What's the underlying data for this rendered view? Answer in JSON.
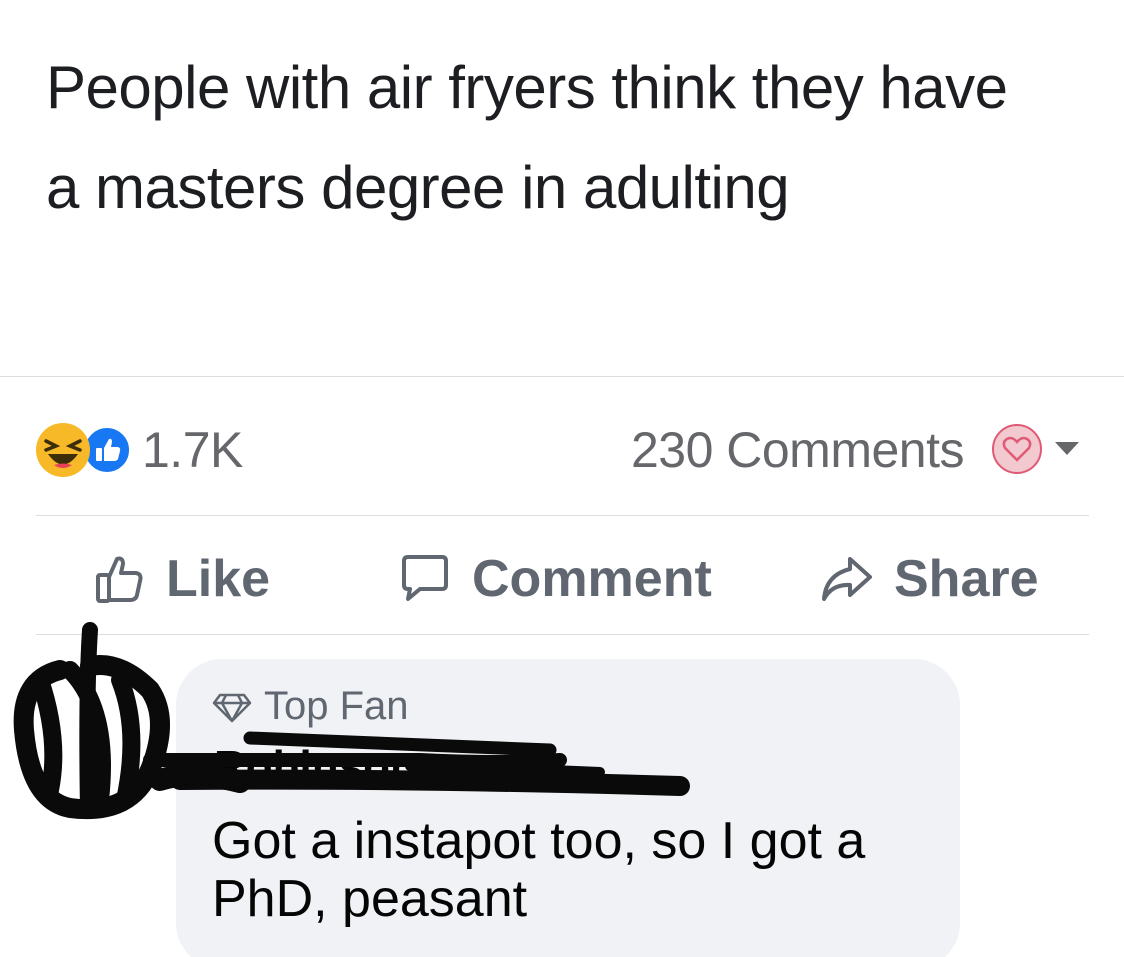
{
  "post": {
    "text": "People with air fryers think they have\na masters degree in adulting"
  },
  "stats": {
    "reactions": [
      "haha-reaction-icon",
      "like-reaction-icon"
    ],
    "reaction_count": "1.7K",
    "comments_count": "230 Comments"
  },
  "actions": {
    "like": "Like",
    "comment": "Comment",
    "share": "Share"
  },
  "comment": {
    "badge": "Top Fan",
    "author": "Robinson",
    "text": "Got a instapot too, so I got a PhD,  peasant"
  },
  "colors": {
    "reaction_gray": "#65676b",
    "action_gray": "#606770",
    "like_blue": "#1877f2",
    "haha_yellow": "#f7b928",
    "bubble_bg": "#f0f2f5"
  }
}
